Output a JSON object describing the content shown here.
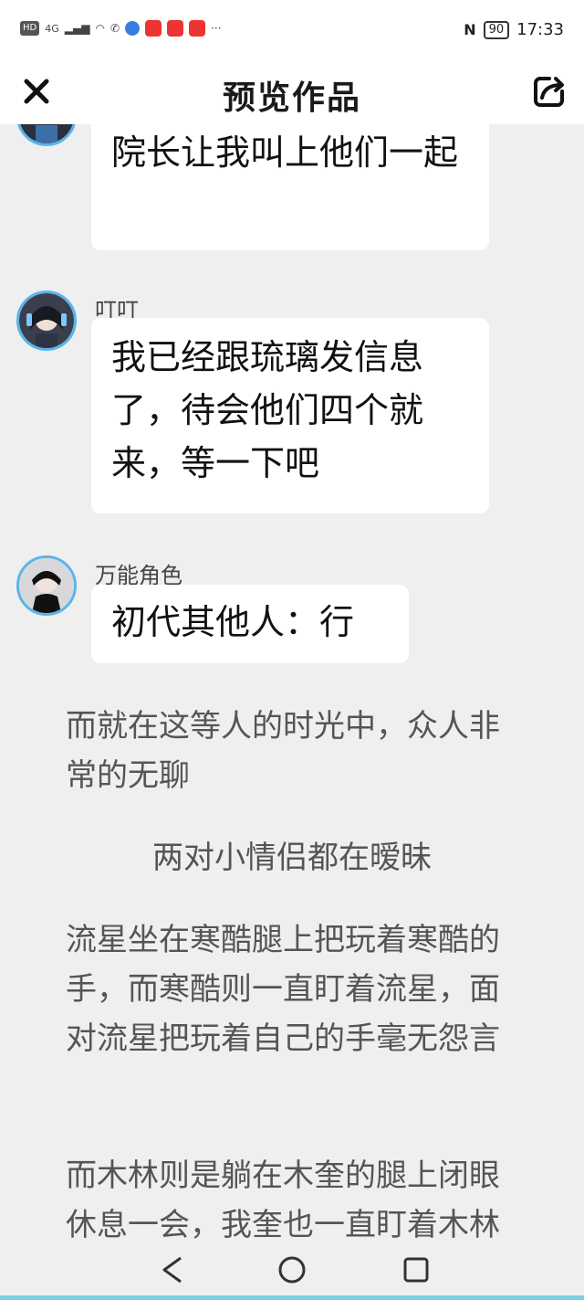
{
  "status_bar": {
    "left_chips": [
      "HD",
      "4G"
    ],
    "time": "17:33",
    "battery": "90"
  },
  "header": {
    "title": "预览作品"
  },
  "chat": {
    "msg1": {
      "text": "院长让我叫上他们一起"
    },
    "msg2": {
      "name": "叮叮",
      "text": "我已经跟琉璃发信息了，待会他们四个就来，等一下吧"
    },
    "msg3": {
      "name": "万能角色",
      "text": "初代其他人：行"
    }
  },
  "narration": {
    "p1": "而就在这等人的时光中，众人非常的无聊",
    "p2": "两对小情侣都在暧昧",
    "p3": "流星坐在寒酷腿上把玩着寒酷的手，而寒酷则一直盯着流星，面对流星把玩着自己的手毫无怨言",
    "p4": "而木林则是躺在木奎的腿上闭眼休息一会，我奎也一直盯着木林"
  },
  "colors": {
    "accent": "#5ab4ea",
    "background": "#efeff0"
  }
}
